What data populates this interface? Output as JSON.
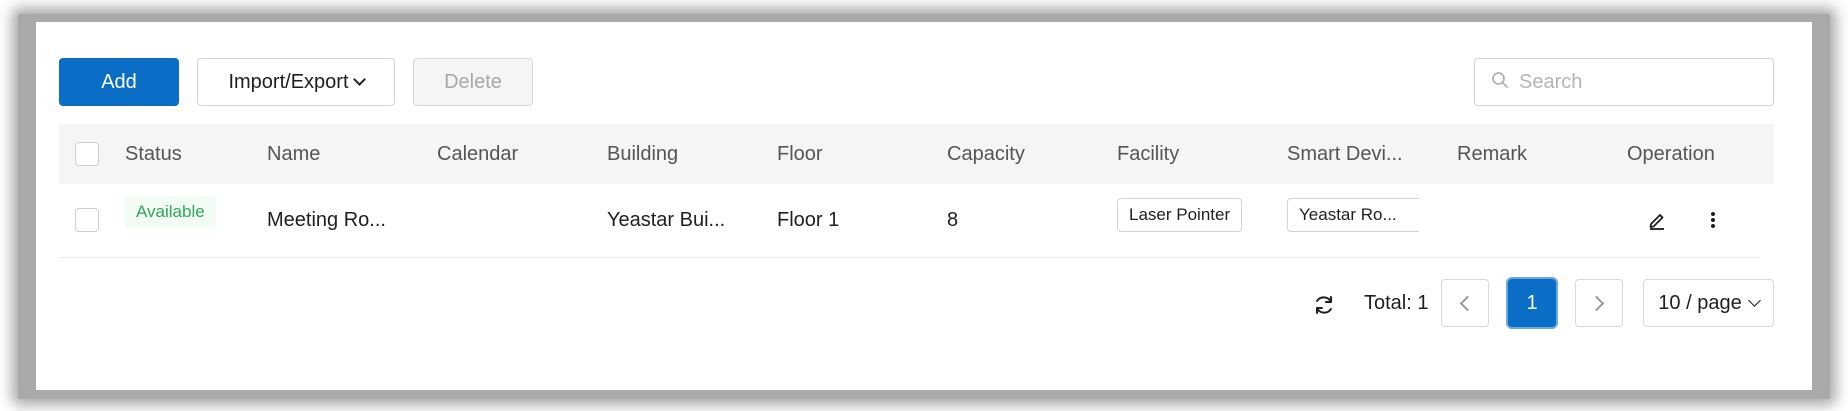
{
  "toolbar": {
    "add_label": "Add",
    "import_export_label": "Import/Export",
    "delete_label": "Delete",
    "search_placeholder": "Search"
  },
  "table": {
    "columns": [
      "Status",
      "Name",
      "Calendar",
      "Building",
      "Floor",
      "Capacity",
      "Facility",
      "Smart Devi...",
      "Remark",
      "Operation"
    ],
    "rows": [
      {
        "status": "Available",
        "name": "Meeting Ro...",
        "calendar": "",
        "building": "Yeastar Bui...",
        "floor": "Floor 1",
        "capacity": "8",
        "facility": "Laser Pointer",
        "smart_device": "Yeastar Ro...",
        "remark": ""
      }
    ]
  },
  "pagination": {
    "total_label": "Total: 1",
    "current_page": "1",
    "page_size": "10 / page"
  },
  "colors": {
    "primary": "#0a6ec6",
    "status_available": "#2fa85a",
    "header_bg": "#f5f5f5"
  },
  "icons": [
    "search-icon",
    "chevron-down-icon",
    "edit-icon",
    "more-vertical-icon",
    "refresh-icon",
    "chevron-left-icon",
    "chevron-right-icon"
  ]
}
